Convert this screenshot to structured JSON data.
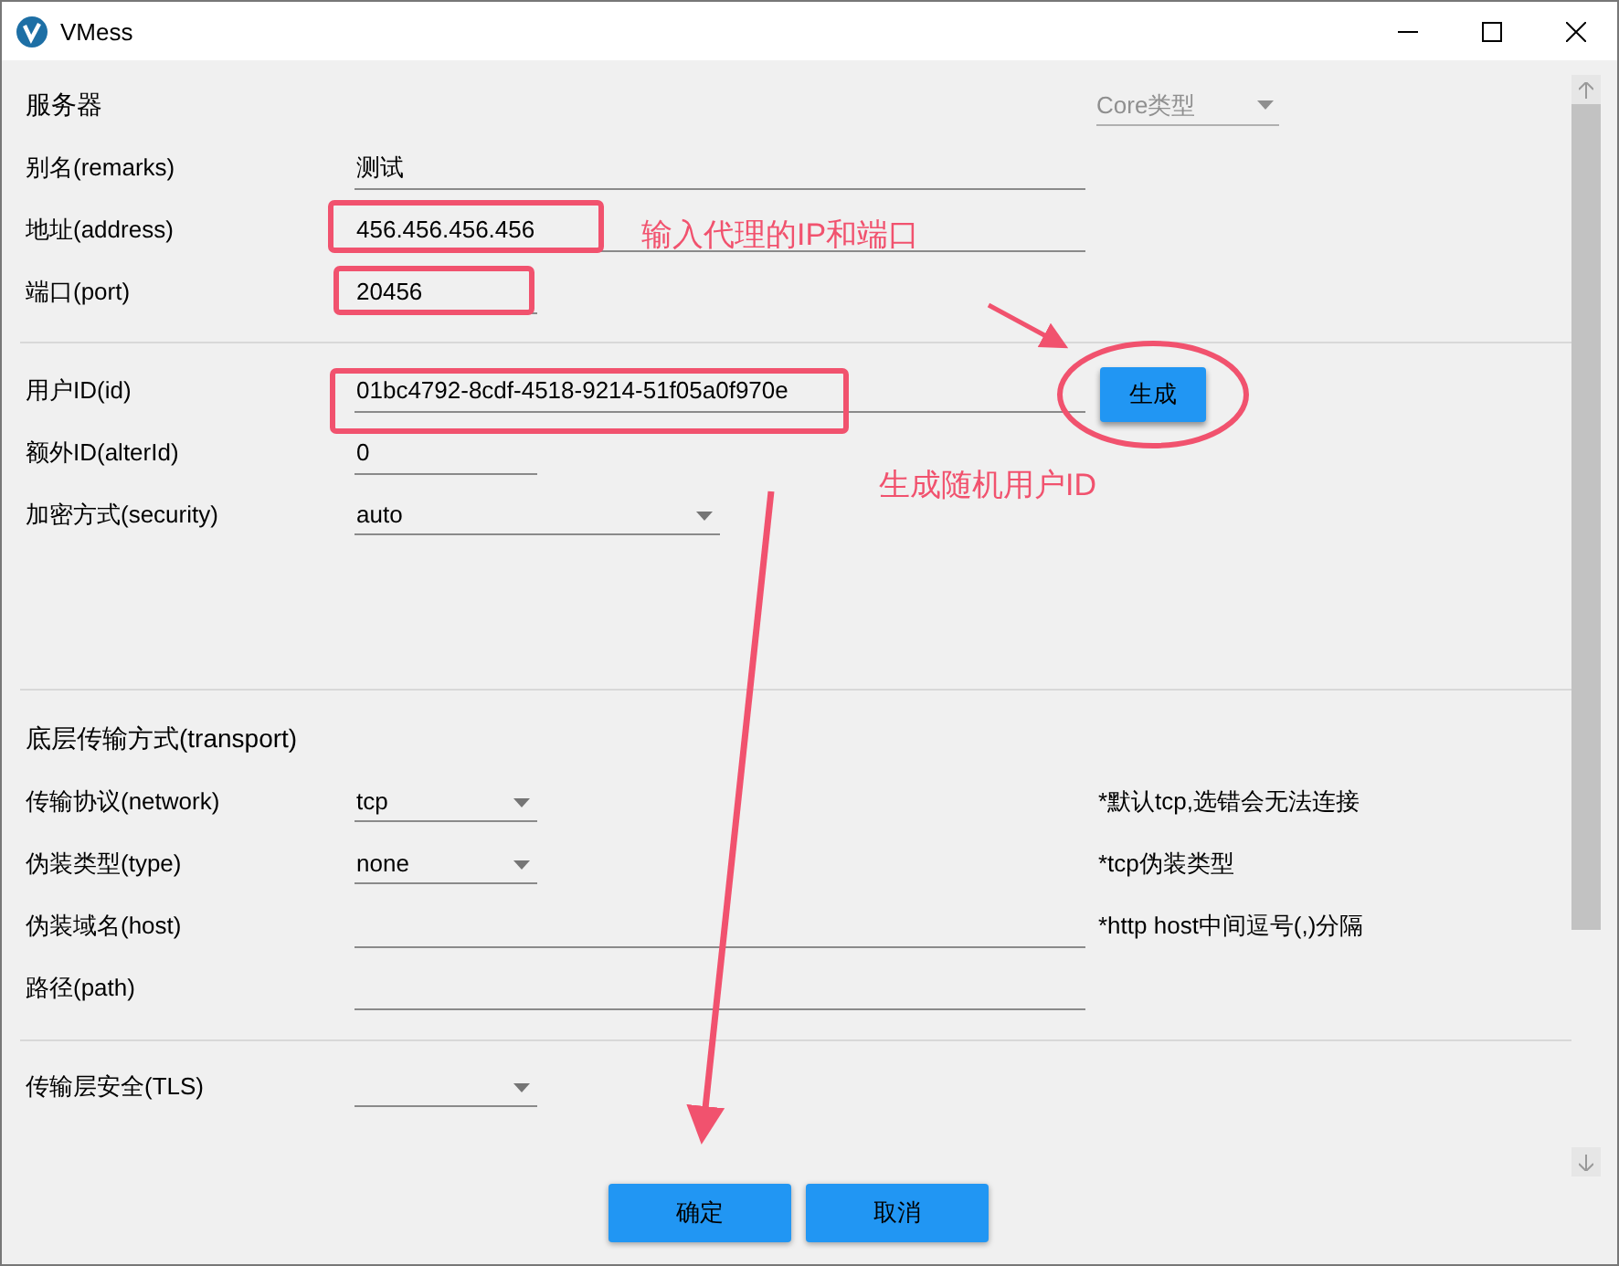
{
  "window": {
    "title": "VMess"
  },
  "sections": [
    {
      "title": "服务器",
      "core_type": {
        "placeholder": "Core类型",
        "disabled": true
      },
      "fields": [
        {
          "kind": "text",
          "label": "别名(remarks)",
          "value": "测试"
        },
        {
          "kind": "text",
          "label": "地址(address)",
          "value": "456.456.456.456"
        },
        {
          "kind": "text",
          "label": "端口(port)",
          "value": "20456"
        }
      ]
    },
    {
      "fields": [
        {
          "kind": "text",
          "label": "用户ID(id)",
          "value": "01bc4792-8cdf-4518-9214-51f05a0f970e",
          "button": "生成"
        },
        {
          "kind": "text",
          "label": "额外ID(alterId)",
          "value": "0"
        },
        {
          "kind": "select",
          "label": "加密方式(security)",
          "value": "auto"
        }
      ]
    },
    {
      "title": "底层传输方式(transport)",
      "fields": [
        {
          "kind": "select",
          "label": "传输协议(network)",
          "value": "tcp",
          "note": "*默认tcp,选错会无法连接"
        },
        {
          "kind": "select",
          "label": "伪装类型(type)",
          "value": "none",
          "note": "*tcp伪装类型"
        },
        {
          "kind": "text",
          "label": "伪装域名(host)",
          "note": "*http host中间逗号(,)分隔"
        },
        {
          "kind": "text",
          "label": "路径(path)"
        }
      ]
    },
    {
      "fields": [
        {
          "kind": "select",
          "label": "传输层安全(TLS)"
        }
      ]
    }
  ],
  "buttons": [
    "确定",
    "取消"
  ],
  "annotations": [
    "输入代理的IP和端口",
    "生成随机用户ID"
  ]
}
